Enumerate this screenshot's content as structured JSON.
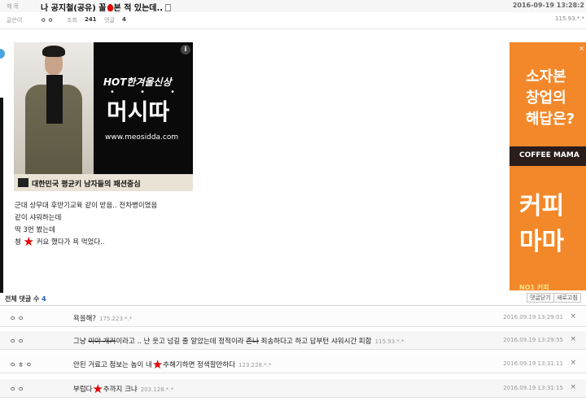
{
  "post": {
    "title_label": "제 목",
    "title_before": "나 공지철(공유) 꼴",
    "title_after": "본 적 있는데..",
    "date": "2016-09-19 13:28:2",
    "author_label": "글쓴이",
    "author": "ㅇ ㅇ",
    "views_label": "조회",
    "views": "241",
    "comments_label": "댓글",
    "comments": "4",
    "ip": "115.93.*.*"
  },
  "ad_left": {
    "hot": "HOT한겨울신상",
    "dots": "• • •",
    "brand": "머시따",
    "url": "www.meosidda.com",
    "footer": "대한민국 평균키 남자들의 패션중심",
    "info": "i"
  },
  "ad_right": {
    "line1": "소자본",
    "line2": "창업의",
    "line3": "해답은?",
    "band": "COFFEE MAMA",
    "big1": "커피",
    "big2": "마마",
    "tail": "NO1 커피",
    "close": "×"
  },
  "body": {
    "line1": "군대 상무대 후반기교육 같이 받음.. 전차병이였음",
    "line2": "같이 샤워하는데",
    "line3": "딱 3번 봤는데",
    "line4_before": "쳥",
    "line4_after": "커요 했다가 욕 먹었다.."
  },
  "comments_head": {
    "label": "전체 댓글 수",
    "count": "4",
    "btn_close": "댓글닫기",
    "btn_refresh": "새로고침"
  },
  "comments": [
    {
      "name": "ㅇ ㅇ",
      "text": "욕을해?",
      "ip": "175.223.*.*",
      "date": "2016.09.19 13:29:01"
    },
    {
      "name": "ㅇ ㅇ",
      "text_before": "그냥",
      "text_strike": "이야 개커",
      "text_after": "이라고 .. 난 웃고 넘길 줄 알았는데 정적이라",
      "text_strike2": "존나",
      "text_after2": " 죄송하다고 하고 답부턴 샤워시간 피함",
      "ip": "115.93.*.*",
      "date": "2016.09.19 13:29:55"
    },
    {
      "name": "ㅇ ㅎ ㅇ",
      "text_before": "안된 거료고 첨보는 놈이 내",
      "text_after": "추해기하면 정색할만하다",
      "ip": "123.228.*.*",
      "date": "2016.09.19 13:31:11"
    },
    {
      "name": "ㅇ ㅇ",
      "text_before": "부럽다",
      "text_after": "추까지 크냐",
      "ip": "203.128.*.*",
      "date": "2016.09.19 13:31:15"
    }
  ],
  "icons": {
    "delete": "×"
  }
}
